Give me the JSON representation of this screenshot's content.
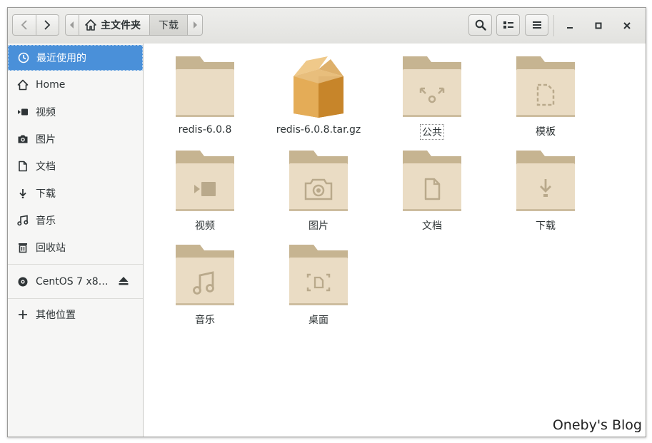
{
  "header": {
    "back_icon": "chevron-left-icon",
    "forward_icon": "chevron-right-icon",
    "path": [
      {
        "label": "主文件夹",
        "icon": "home-icon"
      },
      {
        "label": "下载"
      }
    ],
    "search_icon": "search-icon",
    "view_icon": "list-view-icon",
    "menu_icon": "hamburger-menu-icon",
    "minimize_icon": "minimize-icon",
    "maximize_icon": "maximize-icon",
    "close_icon": "close-icon"
  },
  "sidebar": {
    "items": [
      {
        "label": "最近使用的",
        "icon": "clock-icon",
        "selected": true
      },
      {
        "label": "Home",
        "icon": "home-icon"
      },
      {
        "label": "视频",
        "icon": "video-icon"
      },
      {
        "label": "图片",
        "icon": "camera-icon"
      },
      {
        "label": "文档",
        "icon": "document-icon"
      },
      {
        "label": "下载",
        "icon": "download-icon"
      },
      {
        "label": "音乐",
        "icon": "music-icon"
      },
      {
        "label": "回收站",
        "icon": "trash-icon"
      }
    ],
    "devices": [
      {
        "label": "CentOS 7 x8…",
        "icon": "disc-icon",
        "action_icon": "eject-icon"
      }
    ],
    "other": {
      "label": "其他位置",
      "icon": "plus-icon"
    }
  },
  "files": [
    {
      "name": "redis-6.0.8",
      "type": "folder",
      "emblem": "none"
    },
    {
      "name": "redis-6.0.8.tar.gz",
      "type": "archive",
      "emblem": "package"
    },
    {
      "name": "公共",
      "type": "folder",
      "emblem": "share"
    },
    {
      "name": "模板",
      "type": "folder",
      "emblem": "template"
    },
    {
      "name": "视频",
      "type": "folder",
      "emblem": "video"
    },
    {
      "name": "图片",
      "type": "folder",
      "emblem": "camera"
    },
    {
      "name": "文档",
      "type": "folder",
      "emblem": "document"
    },
    {
      "name": "下载",
      "type": "folder",
      "emblem": "download"
    },
    {
      "name": "音乐",
      "type": "folder",
      "emblem": "music"
    },
    {
      "name": "桌面",
      "type": "folder",
      "emblem": "desktop"
    }
  ],
  "watermark": "Oneby's Blog",
  "colors": {
    "selection": "#4a90d9",
    "folder_body": "#e9dcc3",
    "folder_tab": "#c7b592",
    "archive": "#d99a3c"
  }
}
